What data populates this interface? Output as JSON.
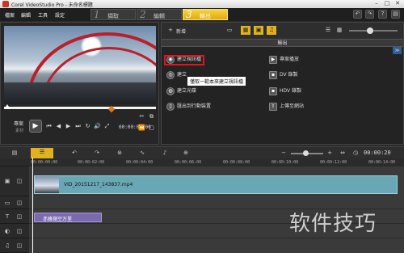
{
  "window": {
    "title": "Corel VideoStudio Pro - 未命名標題"
  },
  "menu": [
    "檔案",
    "編輯",
    "工具",
    "設定"
  ],
  "steps": [
    {
      "num": "1",
      "label": "擷取"
    },
    {
      "num": "2",
      "label": "編輯"
    },
    {
      "num": "3",
      "label": "輸出"
    }
  ],
  "preview": {
    "mode_project": "專案",
    "mode_clip": "素材",
    "timecode": "00:00:00:00"
  },
  "library": {
    "add_label": "新增",
    "header": "輸出",
    "options_left": [
      "建立視訊檔",
      "建立",
      "建立光碟",
      "匯出到行動裝置"
    ],
    "options_right": [
      "專案播放",
      "DV 錄製",
      "HDV 錄製",
      "上傳至網站"
    ],
    "tooltip": "僅取一範本來建立視訊檔"
  },
  "timeline": {
    "timecode": "00:00:20",
    "ruler": [
      "00:00:00:00",
      "00:00:02:00",
      "00:00:04:00",
      "00:00:06:00",
      "00:00:08:00",
      "00:00:10:00",
      "00:00:12:00",
      "00:00:14:00"
    ],
    "video_clip": "VID_20151217_143837.mp4",
    "title_clip": "赤峰嶺空万里"
  },
  "watermark": "软件技巧",
  "colors": {
    "accent": "#f0c21d",
    "highlight": "#e3141b",
    "video_clip": "#6aa7b4",
    "title_clip": "#7a6bb0"
  }
}
